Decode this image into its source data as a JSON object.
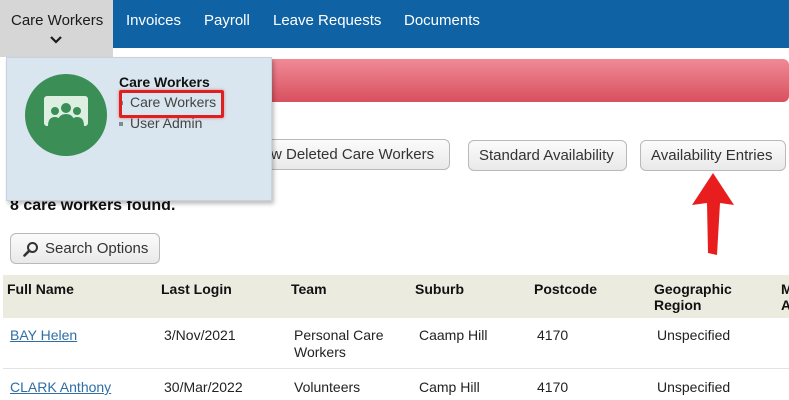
{
  "nav": {
    "active": "Care Workers",
    "items": [
      "Invoices",
      "Payroll",
      "Leave Requests",
      "Documents"
    ]
  },
  "dropdown": {
    "title": "Care Workers",
    "items": [
      "Care Workers",
      "User Admin"
    ]
  },
  "toolbar": {
    "deleted_label": "w Deleted Care Workers",
    "standard_label": "Standard Availability",
    "entries_label": "Availability Entries"
  },
  "results": {
    "count_text": "8 care workers found.",
    "search_options_label": "Search Options"
  },
  "table": {
    "headers": {
      "full_name": "Full Name",
      "last_login": "Last Login",
      "team": "Team",
      "suburb": "Suburb",
      "postcode": "Postcode",
      "region_1": "Geographic",
      "region_2": "Region",
      "cut_1": "M",
      "cut_2": "A"
    },
    "rows": [
      {
        "name": "BAY Helen",
        "last_login": "3/Nov/2021",
        "team_1": "Personal Care",
        "team_2": "Workers",
        "suburb": "Caamp Hill",
        "postcode": "4170",
        "region": "Unspecified"
      },
      {
        "name": "CLARK Anthony",
        "last_login": "30/Mar/2022",
        "team_1": "Volunteers",
        "team_2": "",
        "suburb": "Camp Hill",
        "postcode": "4170",
        "region": "Unspecified"
      }
    ]
  },
  "colors": {
    "nav_bg": "#0f63a4",
    "banner": "#e0606c",
    "highlight": "#e02020",
    "arrow": "#e81e1e",
    "avatar_circle": "#3a8e56"
  },
  "icons": {
    "chevron": "chevron-down-icon",
    "search": "magnifier-icon",
    "group": "people-group-icon"
  }
}
